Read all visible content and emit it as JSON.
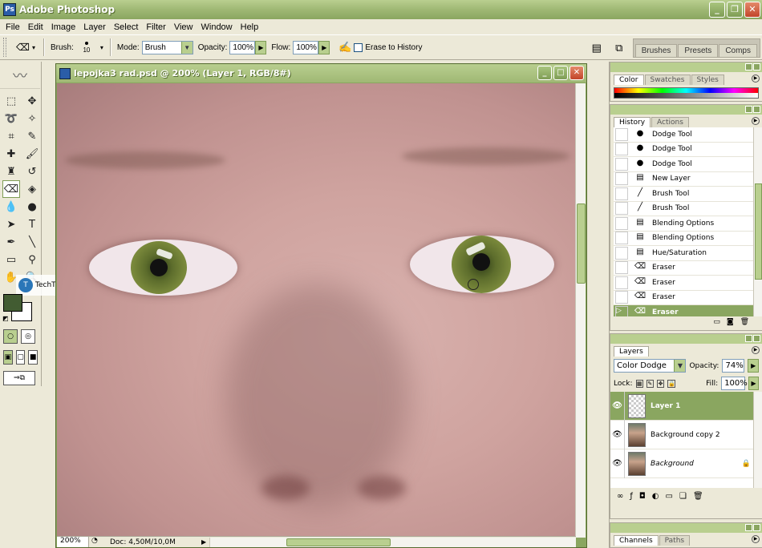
{
  "app": {
    "title": "Adobe Photoshop",
    "window_buttons": {
      "minimize": "_",
      "restore": "❐",
      "close": "✕"
    }
  },
  "menu": [
    "File",
    "Edit",
    "Image",
    "Layer",
    "Select",
    "Filter",
    "View",
    "Window",
    "Help"
  ],
  "options": {
    "brush_label": "Brush:",
    "brush_size": "10",
    "mode_label": "Mode:",
    "mode_value": "Brush",
    "opacity_label": "Opacity:",
    "opacity_value": "100%",
    "flow_label": "Flow:",
    "flow_value": "100%",
    "erase_to_history_label": "Erase to History",
    "erase_to_history_checked": false
  },
  "palette_well": {
    "tabs": [
      "Brushes",
      "Presets",
      "Comps"
    ]
  },
  "document": {
    "title": "lepojka3 rad.psd @ 200% (Layer 1, RGB/8#)",
    "zoom": "200%",
    "doc_info": "Doc: 4,50M/10,0M"
  },
  "watermark": {
    "text": "TechTut.com"
  },
  "colors": {
    "foreground": "#425c32",
    "background": "#ffffff",
    "accent": "#8aa660"
  },
  "color_panel": {
    "tabs": [
      "Color",
      "Swatches",
      "Styles"
    ]
  },
  "history_panel": {
    "tabs": [
      "History",
      "Actions"
    ],
    "items": [
      {
        "label": "Dodge Tool",
        "icon": "dodge-icon"
      },
      {
        "label": "Dodge Tool",
        "icon": "dodge-icon"
      },
      {
        "label": "Dodge Tool",
        "icon": "dodge-icon"
      },
      {
        "label": "New Layer",
        "icon": "document-icon"
      },
      {
        "label": "Brush Tool",
        "icon": "brush-icon"
      },
      {
        "label": "Brush Tool",
        "icon": "brush-icon"
      },
      {
        "label": "Blending Options",
        "icon": "document-icon"
      },
      {
        "label": "Blending Options",
        "icon": "document-icon"
      },
      {
        "label": "Hue/Saturation",
        "icon": "document-icon"
      },
      {
        "label": "Eraser",
        "icon": "eraser-icon"
      },
      {
        "label": "Eraser",
        "icon": "eraser-icon"
      },
      {
        "label": "Eraser",
        "icon": "eraser-icon"
      },
      {
        "label": "Eraser",
        "icon": "eraser-icon",
        "selected": true
      }
    ]
  },
  "layers_panel": {
    "tab": "Layers",
    "blend_mode": "Color Dodge",
    "opacity_label": "Opacity:",
    "opacity_value": "74%",
    "lock_label": "Lock:",
    "fill_label": "Fill:",
    "fill_value": "100%",
    "layers": [
      {
        "name": "Layer 1",
        "selected": true,
        "thumb": "transparent"
      },
      {
        "name": "Background copy 2",
        "selected": false,
        "thumb": "photo"
      },
      {
        "name": "Background",
        "selected": false,
        "thumb": "photo",
        "italic": true,
        "locked": true
      }
    ]
  },
  "channels_panel": {
    "tabs": [
      "Channels",
      "Paths"
    ]
  }
}
